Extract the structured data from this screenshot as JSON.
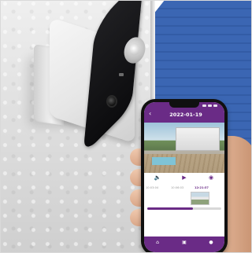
{
  "app": {
    "header_date": "2022-01-19",
    "back_glyph": "‹",
    "status_icons": [
      "signal-icon",
      "wifi-icon",
      "battery-icon"
    ]
  },
  "video": {
    "scene": "live-camera-view"
  },
  "controls": [
    {
      "name": "volume-icon",
      "glyph": "🔈"
    },
    {
      "name": "play-icon",
      "glyph": "▶"
    },
    {
      "name": "camera-icon",
      "glyph": "◉"
    }
  ],
  "timeline": {
    "times": [
      "10:03:04",
      "10:06:03",
      "12:21:37"
    ],
    "active_index": 2,
    "progress": 0.62
  },
  "bottom_nav": [
    {
      "name": "home-icon",
      "glyph": "⌂"
    },
    {
      "name": "gallery-icon",
      "glyph": "▣"
    },
    {
      "name": "profile-icon",
      "glyph": "●"
    }
  ],
  "colors": {
    "brand": "#6a2b86",
    "wall": "#e3e3e3",
    "siding": "#3b66b3",
    "camera_body": "#e6e6e6",
    "camera_face": "#111111"
  }
}
